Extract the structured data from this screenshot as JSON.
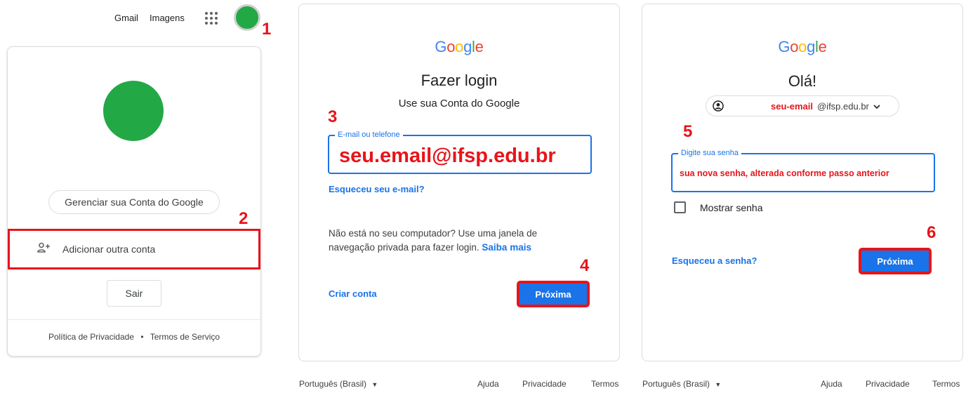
{
  "topbar": {
    "gmail": "Gmail",
    "images": "Imagens"
  },
  "account_menu": {
    "manage_label": "Gerenciar sua Conta do Google",
    "add_account_label": "Adicionar outra conta",
    "logout_label": "Sair",
    "privacy": "Política de Privacidade",
    "separator": "•",
    "terms": "Termos de Serviço",
    "avatar_color": "#23a846"
  },
  "logo": [
    "G",
    "o",
    "o",
    "g",
    "l",
    "e"
  ],
  "logo_colors": [
    "#4285f4",
    "#ea4335",
    "#fbbc05",
    "#4285f4",
    "#34a853",
    "#ea4335"
  ],
  "login": {
    "title": "Fazer login",
    "subtitle": "Use sua Conta do Google",
    "field_label": "E-mail ou telefone",
    "email_value": "seu.email@ifsp.edu.br",
    "forgot_email": "Esqueceu seu e-mail?",
    "note_text": "Não está no seu computador? Use uma janela de navegação privada para fazer login.",
    "learn_more": "Saiba mais",
    "create_account": "Criar conta",
    "next": "Próxima"
  },
  "password": {
    "title": "Olá!",
    "chip_user": "seu-email",
    "chip_domain": "@ifsp.edu.br",
    "field_label": "Digite sua senha",
    "password_value": "sua nova senha, alterada conforme passo anterior",
    "show_password": "Mostrar senha",
    "forgot_password": "Esqueceu a senha?",
    "next": "Próxima"
  },
  "footer": {
    "language": "Português (Brasil)",
    "help": "Ajuda",
    "privacy": "Privacidade",
    "terms": "Termos"
  },
  "steps": [
    "1",
    "2",
    "3",
    "4",
    "5",
    "6"
  ],
  "colors": {
    "accent": "#1a73e8",
    "annotation_red": "#e8141a"
  }
}
